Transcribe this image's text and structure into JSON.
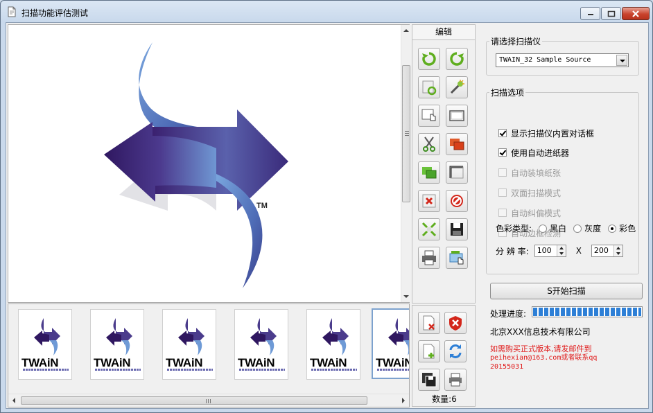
{
  "window": {
    "title": "扫描功能评估测试"
  },
  "tools": {
    "edit_label": "编辑",
    "count_label": "数量:6"
  },
  "scanner": {
    "group_label": "请选择扫描仪",
    "selected_source": "TWAIN_32 Sample Source"
  },
  "options": {
    "group_label": "扫描选项",
    "checkboxes": [
      {
        "label": "显示扫描仪内置对话框",
        "checked": true,
        "enabled": true
      },
      {
        "label": "使用自动进纸器",
        "checked": true,
        "enabled": true
      },
      {
        "label": "自动装填纸张",
        "checked": false,
        "enabled": false
      },
      {
        "label": "双面扫描模式",
        "checked": false,
        "enabled": false
      },
      {
        "label": "自动纠偏模式",
        "checked": false,
        "enabled": false
      },
      {
        "label": "自动边框检测",
        "checked": false,
        "enabled": false
      }
    ],
    "color_type_label": "色彩类型:",
    "color_options": [
      "黑白",
      "灰度",
      "彩色"
    ],
    "color_selected": "彩色",
    "resolution_label": "分 辨 率:",
    "resolution_x": "100",
    "resolution_sep": "X",
    "resolution_y": "200"
  },
  "scan_button": "S开始扫描",
  "progress": {
    "label": "处理进度:",
    "value": 1.0
  },
  "company": "北京XXX信息技术有限公司",
  "notice": {
    "line1": "如需购买正式版本,请发邮件到",
    "line2": "peihexian@163.com或者联系qq",
    "line3": "20155031"
  },
  "thumbnails": {
    "word": "TWAiN"
  },
  "logo": {
    "tm": "TM"
  },
  "colors": {
    "logo_dark": "#3a1f6e",
    "logo_light": "#6e9ad6",
    "notice_red": "#e01b1b",
    "progress_blue": "#2d7fd6"
  }
}
